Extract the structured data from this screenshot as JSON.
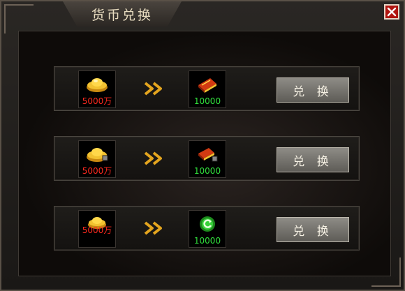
{
  "window": {
    "title": "货币兑换",
    "close_icon": "close-icon"
  },
  "rows": [
    {
      "source_value": "5000万",
      "source_icon": "gold-ingot-icon",
      "target_value": "10000",
      "target_icon": "red-book-icon",
      "button_label": "兑 换"
    },
    {
      "source_value": "5000万",
      "source_icon": "gold-ingot-bound-icon",
      "target_value": "10000",
      "target_icon": "red-book-bound-icon",
      "button_label": "兑 换"
    },
    {
      "source_value": "5000万",
      "source_icon": "gold-ingot-small-icon",
      "target_value": "10000",
      "target_icon": "green-gem-icon",
      "button_label": "兑 换"
    }
  ],
  "colors": {
    "source_value": "#ff2a1f",
    "target_value": "#31e13c",
    "close": "#b01510"
  }
}
